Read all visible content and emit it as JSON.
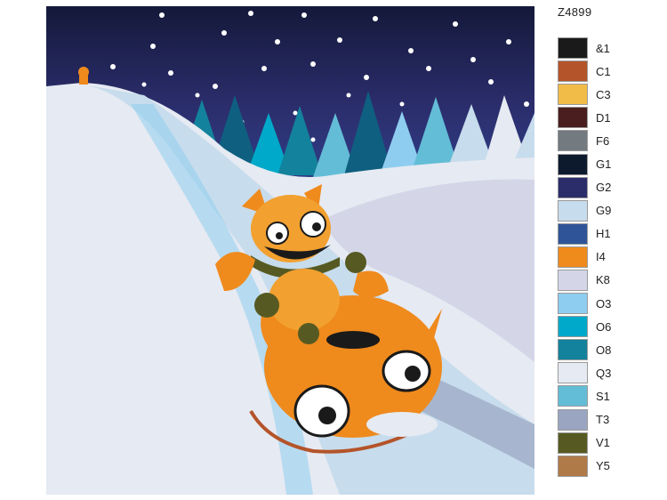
{
  "product_code": "Z4899",
  "palette": [
    {
      "code": "&1",
      "color": "#1a1a1a"
    },
    {
      "code": "C1",
      "color": "#b4542a"
    },
    {
      "code": "C3",
      "color": "#f2bc48"
    },
    {
      "code": "D1",
      "color": "#4a1e1e"
    },
    {
      "code": "F6",
      "color": "#737a80"
    },
    {
      "code": "G1",
      "color": "#0d1a2e"
    },
    {
      "code": "G2",
      "color": "#2b2d6b"
    },
    {
      "code": "G9",
      "color": "#c7dcec"
    },
    {
      "code": "H1",
      "color": "#2f5497"
    },
    {
      "code": "I4",
      "color": "#ef8a1d"
    },
    {
      "code": "K8",
      "color": "#d4d6e8"
    },
    {
      "code": "O3",
      "color": "#8ecdf0"
    },
    {
      "code": "O6",
      "color": "#00a9c9"
    },
    {
      "code": "O8",
      "color": "#13829c"
    },
    {
      "code": "Q3",
      "color": "#e6eaf2"
    },
    {
      "code": "S1",
      "color": "#63bdd6"
    },
    {
      "code": "T3",
      "color": "#9aa5c2"
    },
    {
      "code": "V1",
      "color": "#565a22"
    },
    {
      "code": "Y5",
      "color": "#b07a48"
    }
  ]
}
